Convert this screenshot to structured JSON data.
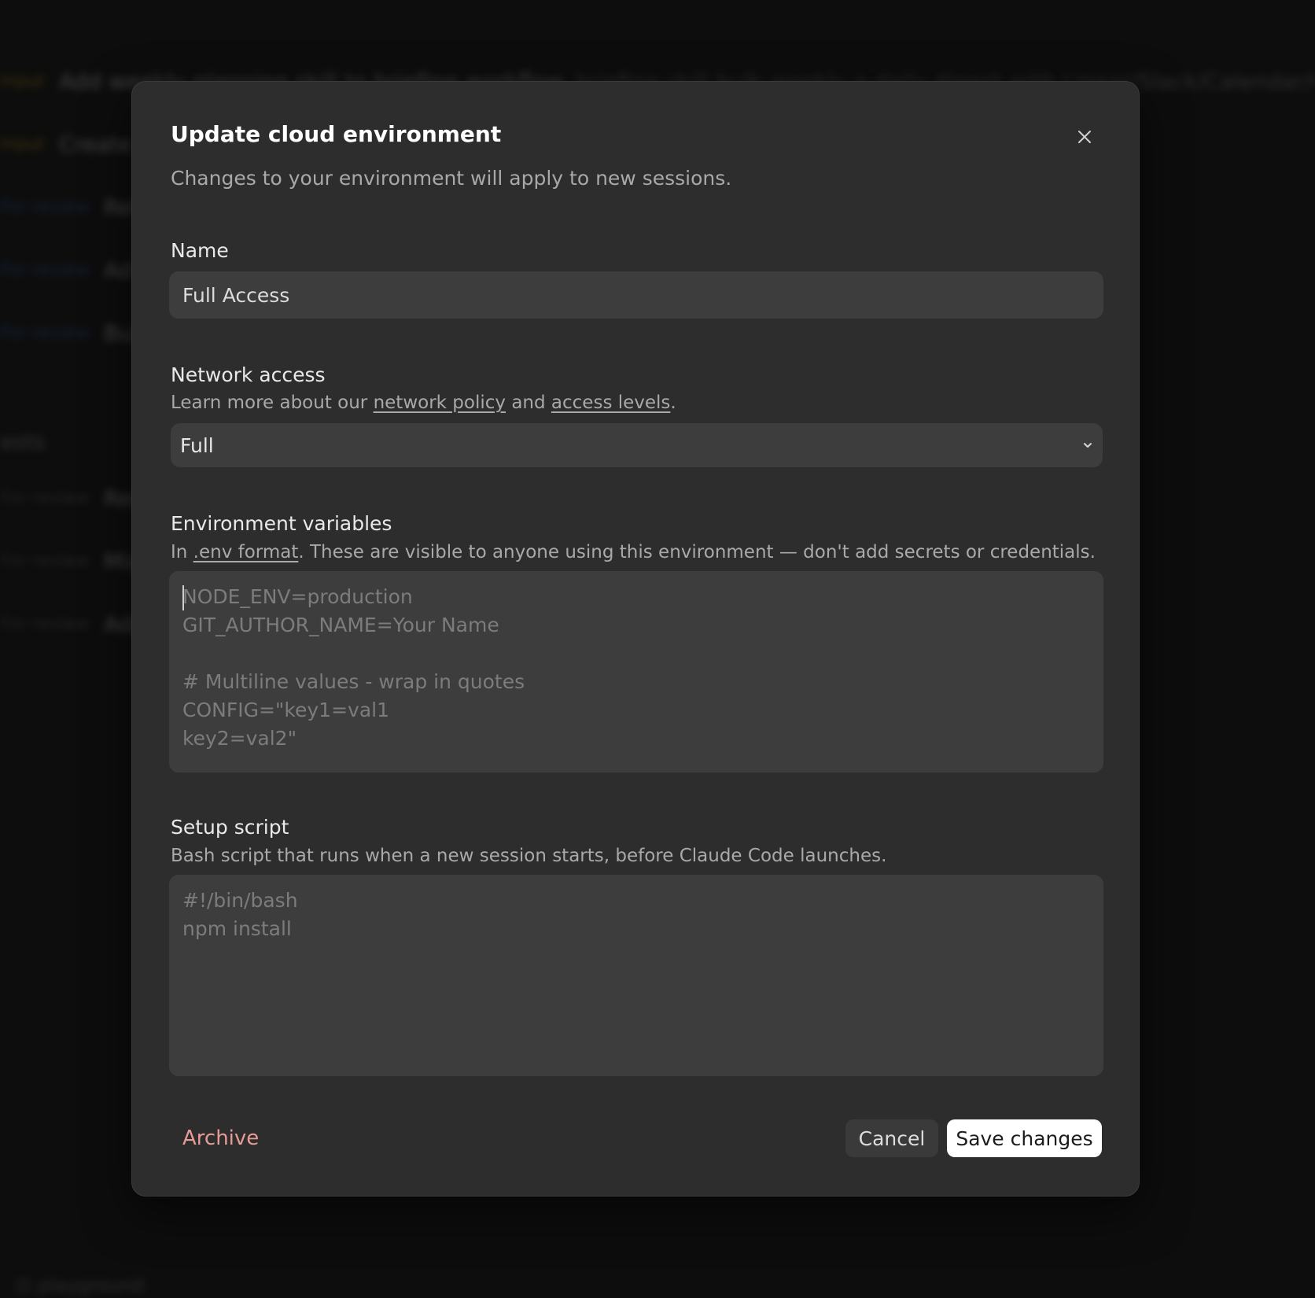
{
  "background": {
    "rows": [
      {
        "tag": "Input",
        "tag_style": "input",
        "title": "Add weekly planning skill to briefing workflow",
        "extra": "briefing skill bulk weekly a daily digest with Linear/Slack/Calendar/GitHub"
      },
      {
        "tag": "Input",
        "tag_style": "input",
        "title": "Create",
        "extra": ""
      },
      {
        "tag": "For review",
        "tag_style": "review",
        "title": "Ref",
        "extra": ""
      },
      {
        "tag": "For review",
        "tag_style": "review",
        "title": "Ad",
        "extra": ""
      },
      {
        "tag": "For review",
        "tag_style": "review",
        "title": "Bui",
        "extra": ""
      },
      {
        "tag": "For review",
        "tag_style": "muted",
        "title": "Red",
        "extra": ""
      },
      {
        "tag": "For review",
        "tag_style": "muted",
        "title": "Mig",
        "extra": ""
      },
      {
        "tag": "For review",
        "tag_style": "muted",
        "title": "Adc",
        "extra": ""
      }
    ],
    "section_label": "ests",
    "footer_label": "⊡ playground"
  },
  "modal": {
    "title": "Update cloud environment",
    "subtitle": "Changes to your environment will apply to new sessions.",
    "close_icon": "close-icon"
  },
  "name_field": {
    "label": "Name",
    "value": "Full Access"
  },
  "network_access": {
    "label": "Network access",
    "help_prefix": "Learn more about our ",
    "link_network_policy": "network policy",
    "help_middle": " and ",
    "link_access_levels": "access levels",
    "help_suffix": ".",
    "selected": "Full",
    "chevron_icon": "chevron-down-icon"
  },
  "env_vars": {
    "label": "Environment variables",
    "help_prefix": "In ",
    "link_env_format": ".env format",
    "help_suffix": ". These are visible to anyone using this environment — don't add secrets or credentials.",
    "value": "",
    "placeholder": "NODE_ENV=production\nGIT_AUTHOR_NAME=Your Name\n\n# Multiline values - wrap in quotes\nCONFIG=\"key1=val1\nkey2=val2\""
  },
  "setup_script": {
    "label": "Setup script",
    "help": "Bash script that runs when a new session starts, before Claude Code launches.",
    "value": "",
    "placeholder": "#!/bin/bash\nnpm install"
  },
  "footer": {
    "archive_label": "Archive",
    "cancel_label": "Cancel",
    "save_label": "Save changes"
  },
  "colors": {
    "accent_danger": "#e89c98",
    "primary_button_bg": "#ffffff",
    "modal_bg": "#2d2d2d",
    "field_bg": "#3d3d3d"
  }
}
